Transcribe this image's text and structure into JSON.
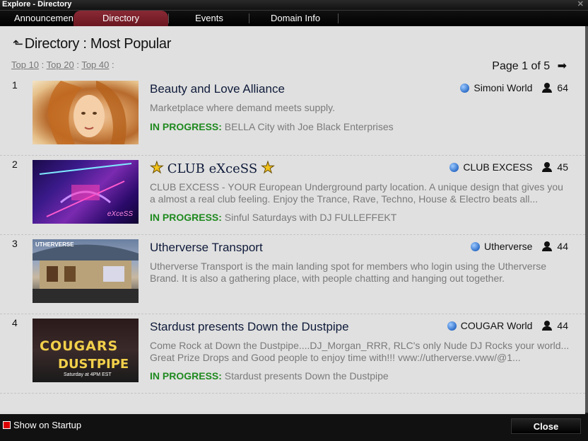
{
  "window": {
    "title": "Explore - Directory"
  },
  "tabs": [
    {
      "label": "Announcements"
    },
    {
      "label": "Directory"
    },
    {
      "label": "Events"
    },
    {
      "label": "Domain Info"
    }
  ],
  "header": {
    "title": "Directory : Most Popular"
  },
  "filters": {
    "top10": "Top 10",
    "top20": "Top 20",
    "top40": "Top 40"
  },
  "pager": {
    "text": "Page 1 of 5"
  },
  "entries": [
    {
      "rank": "1",
      "title": "Beauty and Love Alliance",
      "world": "Simoni World",
      "users": "64",
      "description": "Marketplace where demand meets supply.",
      "progress_label": "IN PROGRESS:",
      "progress_text": "BELLA City with Joe Black Enterprises"
    },
    {
      "rank": "2",
      "title": "CLUB eXceSS",
      "world": "CLUB EXCESS",
      "users": "45",
      "description": "CLUB EXCESS - YOUR European Underground party location. A unique design that gives you a almost a real club feeling. Enjoy the Trance, Rave, Techno, House & Electro beats all...",
      "progress_label": "IN PROGRESS:",
      "progress_text": "Sinful Saturdays with DJ FULLEFFEKT"
    },
    {
      "rank": "3",
      "title": "Utherverse Transport",
      "world": "Utherverse",
      "users": "44",
      "description": "Utherverse Transport is the main landing spot for members who login using the Utherverse Brand. It is also a gathering place, with people chatting and hanging out together."
    },
    {
      "rank": "4",
      "title": "Stardust presents Down the Dustpipe",
      "world": "COUGAR World",
      "users": "44",
      "description": "Come Rock at Down the Dustpipe....DJ_Morgan_RRR, RLC's only Nude DJ Rocks your world... Great Prize Drops and Good people to enjoy time with!!! vww://utherverse.vww/@1...",
      "progress_label": "IN PROGRESS:",
      "progress_text": "Stardust presents Down the Dustpipe",
      "thumb_text_1": "COUGARS",
      "thumb_text_2": "DUSTPIPE",
      "thumb_text_3": "Saturday at 4PM EST"
    }
  ],
  "thumbs": {
    "club_tag": "eXceSS",
    "uth_tag": "UTHERVERSE"
  },
  "footer": {
    "startup_label": "Show on Startup",
    "close_label": "Close"
  }
}
